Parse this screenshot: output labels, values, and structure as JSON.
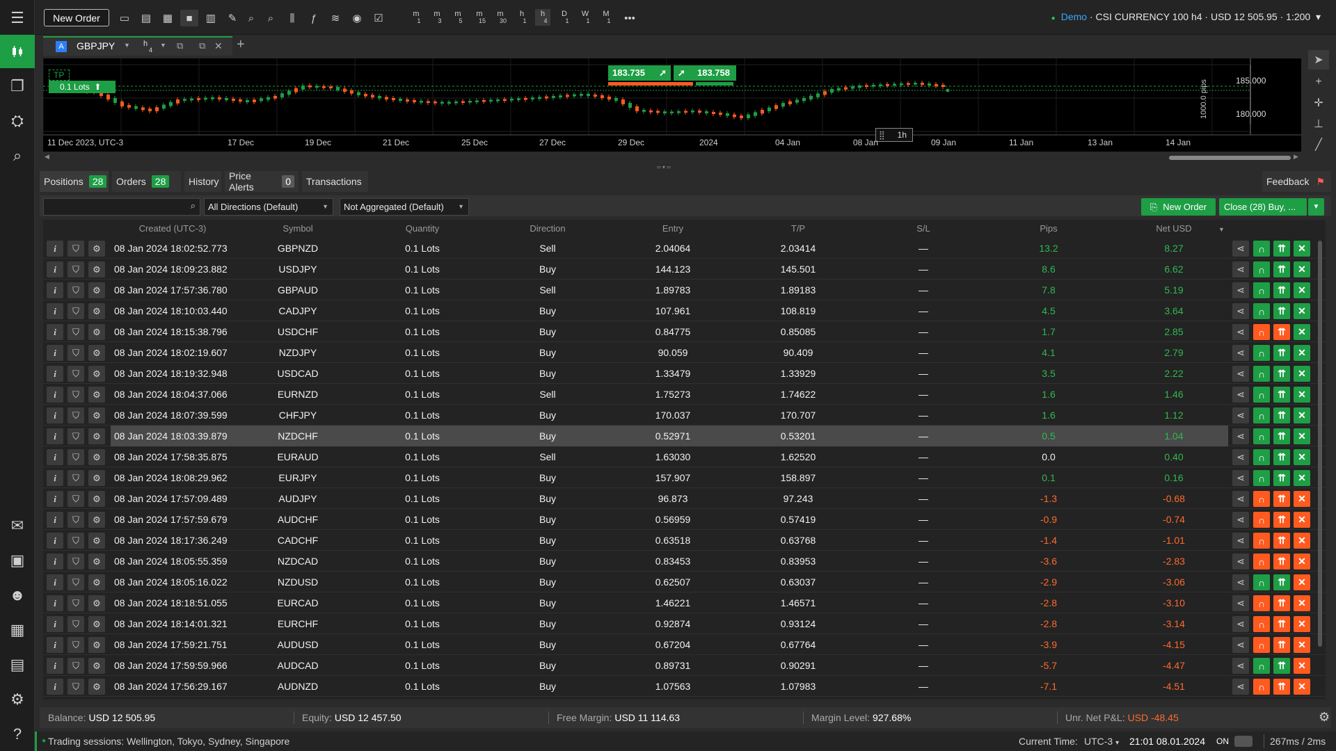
{
  "toolbar": {
    "new_order_label": "New Order",
    "timeframes": [
      {
        "main": "m",
        "sub": "1"
      },
      {
        "main": "m",
        "sub": "3"
      },
      {
        "main": "m",
        "sub": "5"
      },
      {
        "main": "m",
        "sub": "15"
      },
      {
        "main": "m",
        "sub": "30"
      },
      {
        "main": "h",
        "sub": "1"
      },
      {
        "main": "h",
        "sub": "4"
      },
      {
        "main": "D",
        "sub": "1"
      },
      {
        "main": "W",
        "sub": "1"
      },
      {
        "main": "M",
        "sub": "1"
      }
    ],
    "more_label": "•••"
  },
  "account": {
    "status_dot": "●",
    "mode": "Demo",
    "info": " · CSI CURRENCY 100 h4 · USD 12 505.95 · 1:200",
    "caret": "▾"
  },
  "chart_tab": {
    "badge": "A",
    "symbol": "GBPJPY",
    "timeframe_main": "h",
    "timeframe_sub": "4",
    "add_label": "+"
  },
  "chart": {
    "tp_label": "TP",
    "position_label": "0.1 Lots",
    "sell_price": "183.735",
    "buy_price": "183.758",
    "price_labels": [
      "185.000",
      "180.000"
    ],
    "pips_label": "1000.0 pips",
    "hover_label": "1h",
    "date_labels": [
      "11 Dec 2023, UTC-3",
      "17 Dec",
      "19 Dec",
      "21 Dec",
      "25 Dec",
      "27 Dec",
      "29 Dec",
      "2024",
      "04 Jan",
      "08 Jan",
      "09 Jan",
      "11 Jan",
      "13 Jan",
      "14 Jan"
    ],
    "colors": {
      "up": "#1e9e45",
      "down": "#ff5a1f",
      "line": "#2fb950"
    }
  },
  "tabs": {
    "positions_label": "Positions",
    "positions_count": "28",
    "orders_label": "Orders",
    "orders_count": "28",
    "history_label": "History",
    "alerts_label": "Price Alerts",
    "alerts_count": "0",
    "transactions_label": "Transactions",
    "feedback_label": "Feedback"
  },
  "filters": {
    "search_placeholder": "",
    "directions": "All Directions (Default)",
    "aggregation": "Not Aggregated (Default)",
    "new_order_label": "New Order",
    "close_label": "Close (28) Buy, ..."
  },
  "columns": [
    "Created (UTC-3)",
    "Symbol",
    "Quantity",
    "Direction",
    "Entry",
    "T/P",
    "S/L",
    "Pips",
    "Net USD"
  ],
  "positions": [
    {
      "created": "08 Jan 2024 18:02:52.773",
      "symbol": "GBPNZD",
      "qty": "0.1 Lots",
      "dir": "Sell",
      "entry": "2.04064",
      "tp": "2.03414",
      "sl": "—",
      "pips": "13.2",
      "net": "8.27"
    },
    {
      "created": "08 Jan 2024 18:09:23.882",
      "symbol": "USDJPY",
      "qty": "0.1 Lots",
      "dir": "Buy",
      "entry": "144.123",
      "tp": "145.501",
      "sl": "—",
      "pips": "8.6",
      "net": "6.62"
    },
    {
      "created": "08 Jan 2024 17:57:36.780",
      "symbol": "GBPAUD",
      "qty": "0.1 Lots",
      "dir": "Sell",
      "entry": "1.89783",
      "tp": "1.89183",
      "sl": "—",
      "pips": "7.8",
      "net": "5.19"
    },
    {
      "created": "08 Jan 2024 18:10:03.440",
      "symbol": "CADJPY",
      "qty": "0.1 Lots",
      "dir": "Buy",
      "entry": "107.961",
      "tp": "108.819",
      "sl": "—",
      "pips": "4.5",
      "net": "3.64"
    },
    {
      "created": "08 Jan 2024 18:15:38.796",
      "symbol": "USDCHF",
      "qty": "0.1 Lots",
      "dir": "Buy",
      "entry": "0.84775",
      "tp": "0.85085",
      "sl": "—",
      "pips": "1.7",
      "net": "2.85"
    },
    {
      "created": "08 Jan 2024 18:02:19.607",
      "symbol": "NZDJPY",
      "qty": "0.1 Lots",
      "dir": "Buy",
      "entry": "90.059",
      "tp": "90.409",
      "sl": "—",
      "pips": "4.1",
      "net": "2.79"
    },
    {
      "created": "08 Jan 2024 18:19:32.948",
      "symbol": "USDCAD",
      "qty": "0.1 Lots",
      "dir": "Buy",
      "entry": "1.33479",
      "tp": "1.33929",
      "sl": "—",
      "pips": "3.5",
      "net": "2.22"
    },
    {
      "created": "08 Jan 2024 18:04:37.066",
      "symbol": "EURNZD",
      "qty": "0.1 Lots",
      "dir": "Sell",
      "entry": "1.75273",
      "tp": "1.74622",
      "sl": "—",
      "pips": "1.6",
      "net": "1.46"
    },
    {
      "created": "08 Jan 2024 18:07:39.599",
      "symbol": "CHFJPY",
      "qty": "0.1 Lots",
      "dir": "Buy",
      "entry": "170.037",
      "tp": "170.707",
      "sl": "—",
      "pips": "1.6",
      "net": "1.12"
    },
    {
      "created": "08 Jan 2024 18:03:39.879",
      "symbol": "NZDCHF",
      "qty": "0.1 Lots",
      "dir": "Buy",
      "entry": "0.52971",
      "tp": "0.53201",
      "sl": "—",
      "pips": "0.5",
      "net": "1.04"
    },
    {
      "created": "08 Jan 2024 17:58:35.875",
      "symbol": "EURAUD",
      "qty": "0.1 Lots",
      "dir": "Sell",
      "entry": "1.63030",
      "tp": "1.62520",
      "sl": "—",
      "pips": "0.0",
      "net": "0.40"
    },
    {
      "created": "08 Jan 2024 18:08:29.962",
      "symbol": "EURJPY",
      "qty": "0.1 Lots",
      "dir": "Buy",
      "entry": "157.907",
      "tp": "158.897",
      "sl": "—",
      "pips": "0.1",
      "net": "0.16"
    },
    {
      "created": "08 Jan 2024 17:57:09.489",
      "symbol": "AUDJPY",
      "qty": "0.1 Lots",
      "dir": "Buy",
      "entry": "96.873",
      "tp": "97.243",
      "sl": "—",
      "pips": "-1.3",
      "net": "-0.68"
    },
    {
      "created": "08 Jan 2024 17:57:59.679",
      "symbol": "AUDCHF",
      "qty": "0.1 Lots",
      "dir": "Buy",
      "entry": "0.56959",
      "tp": "0.57419",
      "sl": "—",
      "pips": "-0.9",
      "net": "-0.74"
    },
    {
      "created": "08 Jan 2024 18:17:36.249",
      "symbol": "CADCHF",
      "qty": "0.1 Lots",
      "dir": "Buy",
      "entry": "0.63518",
      "tp": "0.63768",
      "sl": "—",
      "pips": "-1.4",
      "net": "-1.01"
    },
    {
      "created": "08 Jan 2024 18:05:55.359",
      "symbol": "NZDCAD",
      "qty": "0.1 Lots",
      "dir": "Buy",
      "entry": "0.83453",
      "tp": "0.83953",
      "sl": "—",
      "pips": "-3.6",
      "net": "-2.83"
    },
    {
      "created": "08 Jan 2024 18:05:16.022",
      "symbol": "NZDUSD",
      "qty": "0.1 Lots",
      "dir": "Buy",
      "entry": "0.62507",
      "tp": "0.63037",
      "sl": "—",
      "pips": "-2.9",
      "net": "-3.06"
    },
    {
      "created": "08 Jan 2024 18:18:51.055",
      "symbol": "EURCAD",
      "qty": "0.1 Lots",
      "dir": "Buy",
      "entry": "1.46221",
      "tp": "1.46571",
      "sl": "—",
      "pips": "-2.8",
      "net": "-3.10"
    },
    {
      "created": "08 Jan 2024 18:14:01.321",
      "symbol": "EURCHF",
      "qty": "0.1 Lots",
      "dir": "Buy",
      "entry": "0.92874",
      "tp": "0.93124",
      "sl": "—",
      "pips": "-2.8",
      "net": "-3.14"
    },
    {
      "created": "08 Jan 2024 17:59:21.751",
      "symbol": "AUDUSD",
      "qty": "0.1 Lots",
      "dir": "Buy",
      "entry": "0.67204",
      "tp": "0.67764",
      "sl": "—",
      "pips": "-3.9",
      "net": "-4.15"
    },
    {
      "created": "08 Jan 2024 17:59:59.966",
      "symbol": "AUDCAD",
      "qty": "0.1 Lots",
      "dir": "Buy",
      "entry": "0.89731",
      "tp": "0.90291",
      "sl": "—",
      "pips": "-5.7",
      "net": "-4.47"
    },
    {
      "created": "08 Jan 2024 17:56:29.167",
      "symbol": "AUDNZD",
      "qty": "0.1 Lots",
      "dir": "Buy",
      "entry": "1.07563",
      "tp": "1.07983",
      "sl": "—",
      "pips": "-7.1",
      "net": "-4.51"
    }
  ],
  "row_buttons": {
    "info": "i",
    "close": "✕"
  },
  "balance_bar": {
    "balance_label": "Balance:",
    "balance": "USD 12 505.95",
    "equity_label": "Equity:",
    "equity": "USD 12 457.50",
    "free_margin_label": "Free Margin:",
    "free_margin": "USD 11 114.63",
    "margin_level_label": "Margin Level:",
    "margin_level": "927.68%",
    "unr_label": "Unr. Net P&L:",
    "unr": "USD -48.45"
  },
  "status_bar": {
    "sessions": "Trading sessions: Wellington, Tokyo, Sydney, Singapore",
    "current_time_label": "Current Time:",
    "tz": "UTC-3",
    "tz_caret": "▾",
    "time": "21:01 08.01.2024",
    "on_label": "ON",
    "latency": "267ms  /  2ms"
  }
}
